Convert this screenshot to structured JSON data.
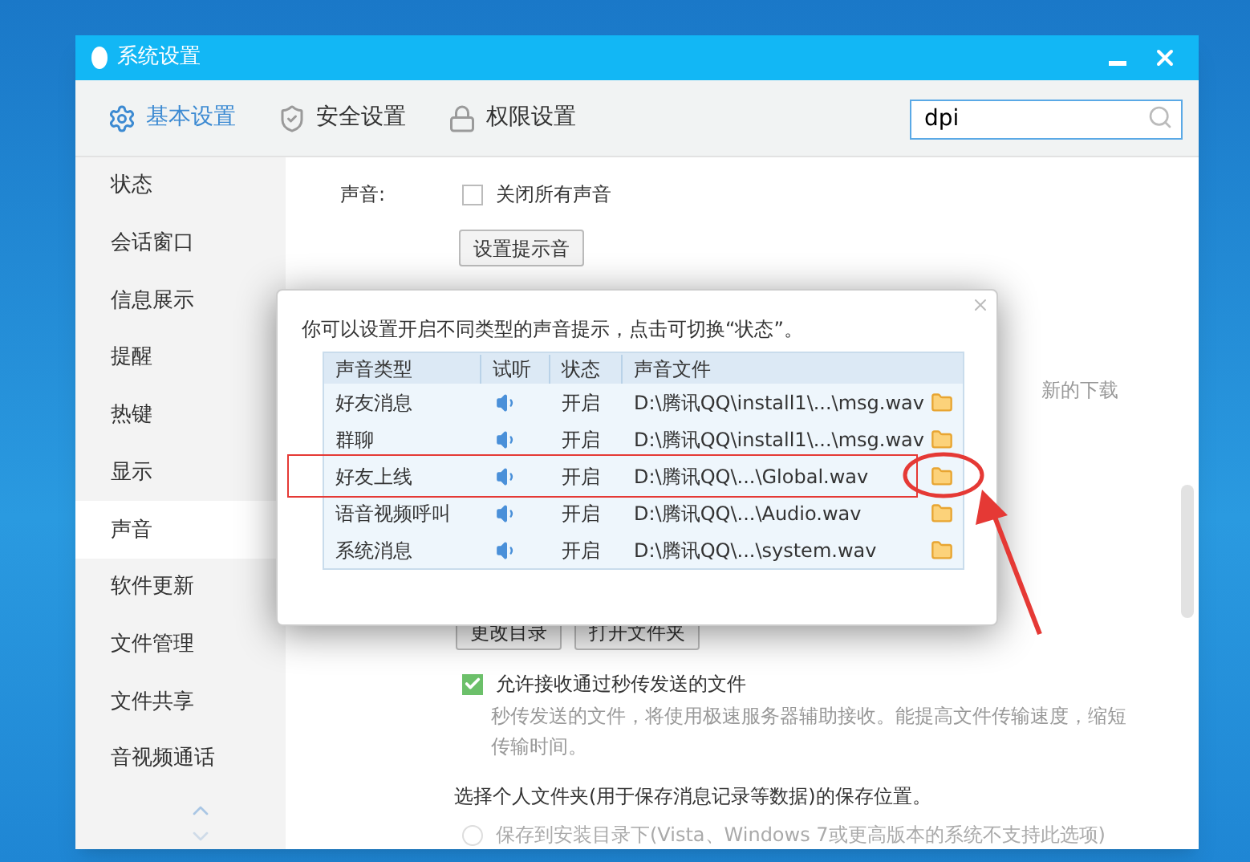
{
  "window": {
    "title": "系统设置"
  },
  "tabs": [
    {
      "label": "基本设置",
      "kind": "gear",
      "selected": true
    },
    {
      "label": "安全设置",
      "kind": "shield",
      "selected": false
    },
    {
      "label": "权限设置",
      "kind": "lock",
      "selected": false
    }
  ],
  "search": {
    "value": "dpi"
  },
  "sidebar": {
    "items": [
      {
        "label": "状态",
        "selected": false
      },
      {
        "label": "会话窗口",
        "selected": false
      },
      {
        "label": "信息展示",
        "selected": false
      },
      {
        "label": "提醒",
        "selected": false
      },
      {
        "label": "热键",
        "selected": false
      },
      {
        "label": "显示",
        "selected": false
      },
      {
        "label": "声音",
        "selected": true
      },
      {
        "label": "软件更新",
        "selected": false
      },
      {
        "label": "文件管理",
        "selected": false
      },
      {
        "label": "文件共享",
        "selected": false
      },
      {
        "label": "音视频通话",
        "selected": false
      }
    ]
  },
  "content": {
    "sound_label": "声音:",
    "mute_all": {
      "label": "关闭所有声音",
      "checked": false
    },
    "set_sound_button": "设置提示音",
    "partial_text": "新的下载",
    "dir_buttons": [
      "更改目录",
      "打开文件夹"
    ],
    "fast_transfer": {
      "label": "允许接收通过秒传发送的文件",
      "checked": true
    },
    "fast_transfer_desc": "秒传发送的文件，将使用极速服务器辅助接收。能提高文件传输速度，缩短传输时间。",
    "folder_title": "选择个人文件夹(用于保存消息记录等数据)的保存位置。",
    "save_option": {
      "label": "保存到安装目录下(Vista、Windows 7或更高版本的系统不支持此选项)",
      "selected": false,
      "disabled": true
    }
  },
  "dialog": {
    "instruction": "你可以设置开启不同类型的声音提示，点击可切换“状态”。",
    "columns": [
      "声音类型",
      "试听",
      "状态",
      "声音文件"
    ],
    "rows": [
      {
        "type": "好友消息",
        "status": "开启",
        "file": "D:\\腾讯QQ\\install1\\...\\msg.wav",
        "annotated": false
      },
      {
        "type": "群聊",
        "status": "开启",
        "file": "D:\\腾讯QQ\\install1\\...\\msg.wav",
        "annotated": false
      },
      {
        "type": "好友上线",
        "status": "开启",
        "file": "D:\\腾讯QQ\\...\\Global.wav",
        "annotated": true
      },
      {
        "type": "语音视频呼叫",
        "status": "开启",
        "file": "D:\\腾讯QQ\\...\\Audio.wav",
        "annotated": false
      },
      {
        "type": "系统消息",
        "status": "开启",
        "file": "D:\\腾讯QQ\\...\\system.wav",
        "annotated": false
      }
    ]
  }
}
